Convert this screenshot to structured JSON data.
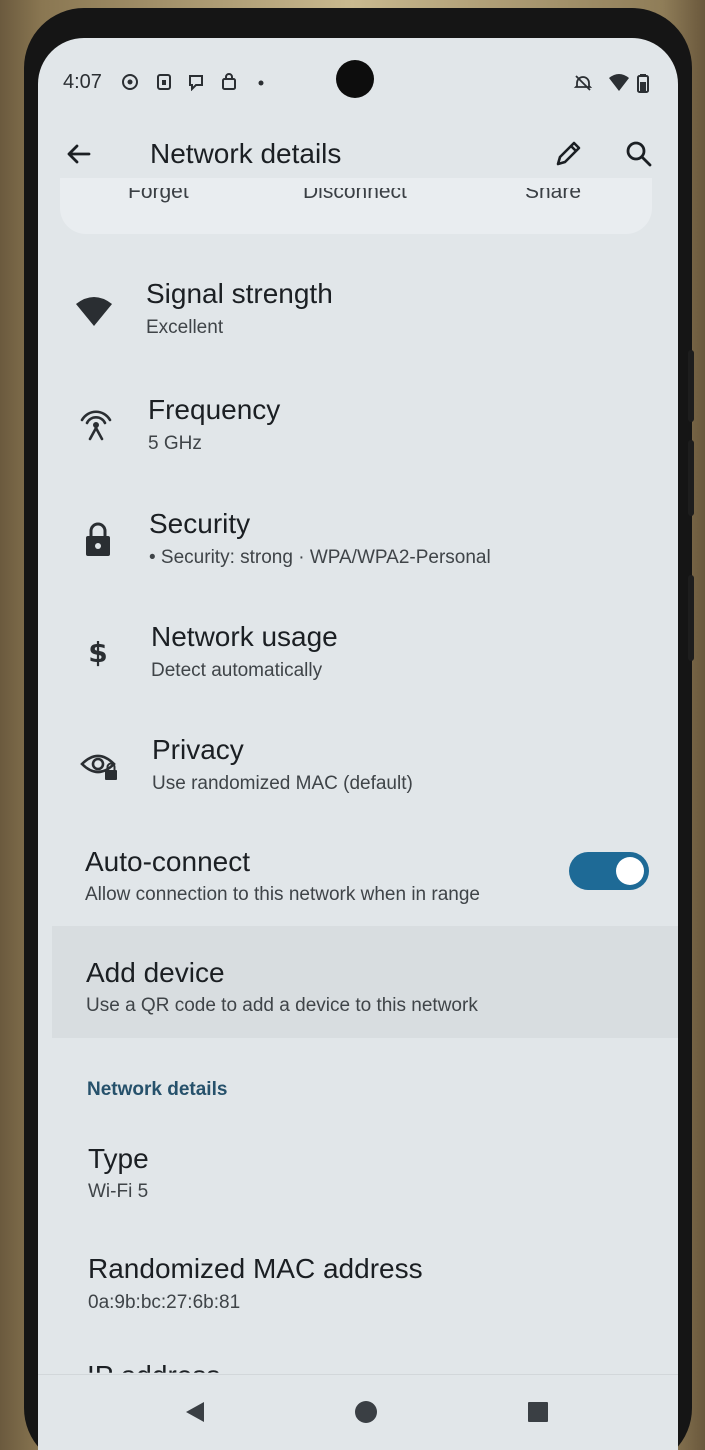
{
  "status_bar": {
    "time": "4:07",
    "left_icons": [
      "circle-notification-icon",
      "sim-notification-icon",
      "message-notification-icon",
      "bag-notification-icon",
      "dot-icon"
    ],
    "right_icons": [
      "silent-icon",
      "wifi-signal-icon",
      "battery-icon"
    ]
  },
  "app_bar": {
    "title": "Network details",
    "back_icon": "arrow-left-icon",
    "edit_icon": "pencil-icon",
    "search_icon": "search-icon"
  },
  "action_buttons": [
    {
      "label": "Forget"
    },
    {
      "label": "Disconnect"
    },
    {
      "label": "Share"
    }
  ],
  "details": [
    {
      "icon": "wifi-icon",
      "title": "Signal strength",
      "subtitle": "Excellent"
    },
    {
      "icon": "antenna-icon",
      "title": "Frequency",
      "subtitle": "5 GHz"
    },
    {
      "icon": "lock-icon",
      "title": "Security",
      "subtitle": "• Security: strong · WPA/WPA2-Personal"
    },
    {
      "icon": "dollar-icon",
      "title": "Network usage",
      "subtitle": "Detect automatically"
    },
    {
      "icon": "privacy-eye-icon",
      "title": "Privacy",
      "subtitle": "Use randomized MAC (default)"
    }
  ],
  "auto_connect": {
    "title": "Auto-connect",
    "subtitle": "Allow connection to this network when in range",
    "enabled": true
  },
  "add_device": {
    "title": "Add device",
    "subtitle": "Use a QR code to add a device to this network"
  },
  "network_section": {
    "header": "Network details",
    "items": [
      {
        "title": "Type",
        "value": "Wi-Fi 5"
      },
      {
        "title": "Randomized MAC address",
        "value": "0a:9b:bc:27:6b:81"
      }
    ],
    "partial_item": "IP address"
  },
  "nav_bar": {
    "back": "back-triangle-icon",
    "home": "home-circle-icon",
    "recents": "recents-square-icon"
  },
  "colors": {
    "screen_bg": "#e1e6e9",
    "accent": "#1e6a96",
    "section_header": "#26516b"
  }
}
